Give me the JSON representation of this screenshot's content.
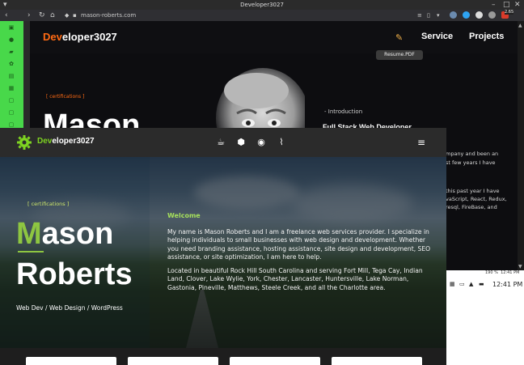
{
  "browser": {
    "window_title": "Developer3027",
    "url": "mason-roberts.com",
    "zoom": "190 %",
    "status_time_small": "12:41 PM",
    "extension_badge": "2.65"
  },
  "taskbar": {
    "time": "12:41 PM"
  },
  "back_site": {
    "logo_accent": "Dev",
    "logo_rest": "eloper3027",
    "nav": {
      "service": "Service",
      "projects": "Projects"
    },
    "tooltip": "Resume.PDF",
    "certifications": "[ certifications ]",
    "name": "Mason",
    "intro": "- Introduction",
    "role": "Full Stack Web Developer",
    "text_lines": [
      "mpany and been an",
      "st few years I have",
      "this past year I have",
      "vaScript, React, Redux,",
      "resql, FireBase, and"
    ]
  },
  "front_site": {
    "logo_accent": "Dev",
    "logo_rest": "eloper3027",
    "certifications": "[ certifications ]",
    "first_name_initial": "M",
    "first_name_rest": "ason",
    "last_name": "Roberts",
    "tagline": "Web Dev / Web Design / WordPress",
    "welcome": "Welcome",
    "paragraph1": "My name is Mason Roberts and I am a freelance web services provider. I specialize in helping individuals to small businesses with web design and development. Whether you need branding assistance, hosting assistance, site design and development, SEO assistance, or site optimization, I am here to help.",
    "paragraph2": "Located in beautiful Rock Hill South Carolina and serving Fort Mill, Tega Cay, Indian Land, Clover, Lake Wylie, York, Chester, Lancaster, Huntersville, Lake Norman, Gastonia, Pineville, Matthews, Steele Creek, and all the Charlotte area."
  },
  "colors": {
    "back_accent": "#ff6a13",
    "front_accent": "#8ec641",
    "welcome": "#a6e05c",
    "sidebar_green": "#48d84a"
  },
  "icons": [
    "coffee-icon",
    "cube-icon",
    "robot-icon",
    "paperclip-icon",
    "hamburger-icon",
    "pen-icon",
    "gear-logo-icon"
  ]
}
